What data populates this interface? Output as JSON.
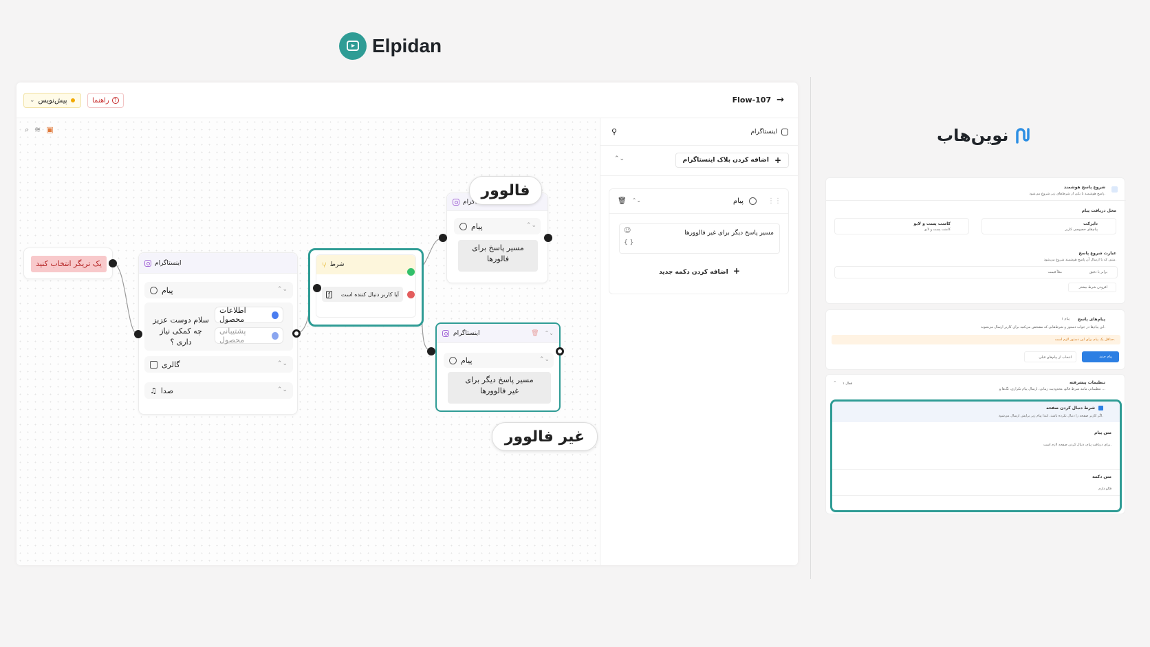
{
  "brand": {
    "name": "Elpidan"
  },
  "editor": {
    "draft_label": "پیش‌نویس",
    "guide_label": "راهنما",
    "flow_title": "Flow-107"
  },
  "trigger_node": {
    "label": "یک تریگر انتخاب کنید"
  },
  "instagram_node": {
    "title": "اینستاگرام",
    "message_label": "پیام",
    "message_text_1": "سلام دوست عزیز",
    "message_text_2": "چه کمکی نیاز داری ؟",
    "button_1": "اطلاعات محصول",
    "button_2": "پشتیبانی محصول",
    "gallery_label": "گالری",
    "audio_label": "صدا"
  },
  "condition_node": {
    "title": "شرط",
    "condition_text": "آیا کاربر دنبال کننده است"
  },
  "follower_node": {
    "title": "اینستاگرام",
    "message_label": "پیام",
    "text_1": "مسیر پاسخ برای",
    "text_2": "فالورها"
  },
  "nonfollower_node": {
    "title": "اینستاگرام",
    "message_label": "پیام",
    "text_1": "مسیر پاسخ دیگر برای",
    "text_2": "غیر فالوورها"
  },
  "tags": {
    "follower": "فالوور",
    "non_follower": "غیر فالوور"
  },
  "sidepanel": {
    "header": "اینستاگرام",
    "add_block": "اضافه کردن بلاک اینستاگرام",
    "message_label": "پیام",
    "message_text": "مسیر پاسخ دیگر برای غیر فالوورها",
    "var_token": "{ }",
    "add_button": "اضافه کردن دکمه جدید"
  },
  "novinhub": {
    "name": "نوین‌هاب",
    "card1_title": "شروع پاسخ هوشمند",
    "card1_sub": "پاسخ هوشمند با یکی از شرط‌های زیر شروع می‌شود.",
    "receive_title": "محل دریافت پیام",
    "direct_label": "دایرکت",
    "direct_sub": "پیام‌های خصوصی کاربر",
    "comment_label": "کامنت پست و لایو",
    "comment_sub": "کامنت پست و لایو",
    "phrase_title": "عبارت شروع پاسخ",
    "phrase_sub": "متنی که با ارسال آن پاسخ هوشمند شروع می‌شود.",
    "equal_label": "برابر با دقیق",
    "example_label": "مثلاً قیمت",
    "add_condition": "افزودن شرط بیشتر",
    "card2_title": "پیام‌های پاسخ",
    "card2_badge": "۱ پیام",
    "card2_sub": "این پیام‌ها در جواب دستور و شرط‌هایی که مشخص می‌کنید برای کاربر ارسال می‌شوند.",
    "warning": "حداقل یک پیام برای این دستور لازم است.",
    "new_message": "پیام جدید",
    "pick_previous": "انتخاب از پیام‌های قبلی",
    "card3_title": "تنظیمات پیشرفته",
    "card3_sub": "تنظیماتی مانند شرط فالو، محدودیت زمانی، ارسال پیام تکراری، تگ‌ها و ...",
    "card3_badge": "۱ فعال",
    "follow_title": "شرط دنبال کردن صفحه",
    "follow_sub": "اگر کاربر صفحه را دنبال نکرده باشد، ابتدا پیام زیر برایش ارسال می‌شود.",
    "msg_text_label": "متن پیام",
    "msg_text_value": "برای دریافت پیام، دنبال کردن صفحه لازم است.",
    "btn_text_label": "متن دکمه",
    "btn_text_value": "فالو دارم"
  },
  "colors": {
    "accent": "#2f9c95",
    "true_port": "#33c06b",
    "false_port": "#e35d5d",
    "trigger_bg": "#f8c9cb"
  }
}
